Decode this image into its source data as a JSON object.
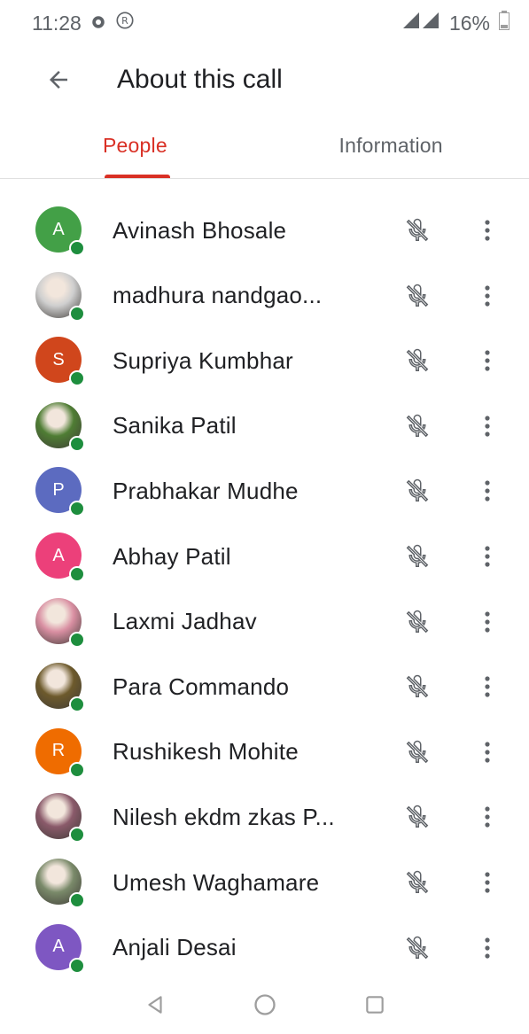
{
  "status_bar": {
    "time": "11:28",
    "battery": "16%"
  },
  "app_bar": {
    "title": "About this call"
  },
  "tabs": [
    {
      "label": "People",
      "active": true
    },
    {
      "label": "Information",
      "active": false
    }
  ],
  "participants": [
    {
      "name": "Avinash Bhosale",
      "initial": "A",
      "color": "#43a047"
    },
    {
      "name": "madhura nandgao...",
      "initial": "",
      "color": "#cfcfcf"
    },
    {
      "name": "Supriya Kumbhar",
      "initial": "S",
      "color": "#d0461c"
    },
    {
      "name": "Sanika Patil",
      "initial": "",
      "color": "#4f7d34"
    },
    {
      "name": "Prabhakar Mudhe",
      "initial": "P",
      "color": "#5c6bc0"
    },
    {
      "name": "Abhay Patil",
      "initial": "A",
      "color": "#ec407a"
    },
    {
      "name": "Laxmi Jadhav",
      "initial": "",
      "color": "#d98fa2"
    },
    {
      "name": "Para Commando",
      "initial": "",
      "color": "#6d5a2c"
    },
    {
      "name": "Rushikesh Mohite",
      "initial": "R",
      "color": "#ef6c00"
    },
    {
      "name": "Nilesh ekdm zkas P...",
      "initial": "",
      "color": "#8a5a6a"
    },
    {
      "name": "Umesh Waghamare",
      "initial": "",
      "color": "#7a8a6a"
    },
    {
      "name": "Anjali Desai",
      "initial": "A",
      "color": "#7e57c2"
    }
  ],
  "colors": {
    "accent": "#d93025",
    "presence": "#1e8e3e",
    "icon": "#5f6368"
  }
}
